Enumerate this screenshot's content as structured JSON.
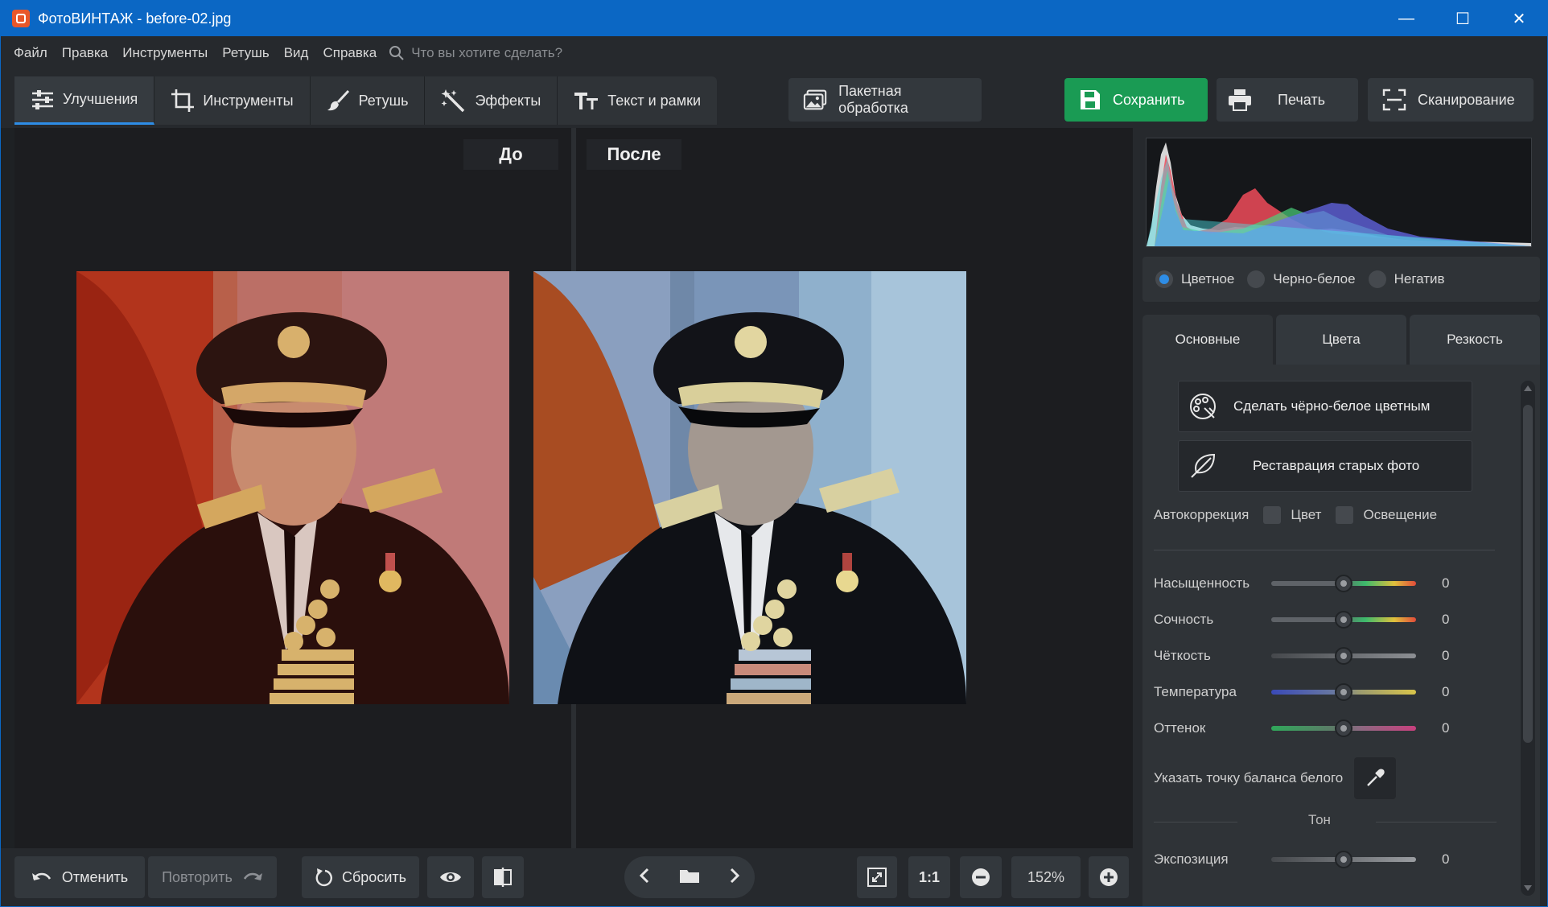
{
  "window": {
    "title": "ФотоВИНТАЖ - before-02.jpg"
  },
  "menu": {
    "items": [
      "Файл",
      "Правка",
      "Инструменты",
      "Ретушь",
      "Вид",
      "Справка"
    ],
    "search_placeholder": "Что вы хотите сделать?"
  },
  "toolbar": {
    "tabs": [
      {
        "label": "Улучшения",
        "icon": "sliders-icon"
      },
      {
        "label": "Инструменты",
        "icon": "crop-icon"
      },
      {
        "label": "Ретушь",
        "icon": "brush-icon"
      },
      {
        "label": "Эффекты",
        "icon": "magic-wand-icon"
      },
      {
        "label": "Текст и рамки",
        "icon": "text-icon"
      }
    ],
    "batch_label": "Пакетная обработка",
    "save_label": "Сохранить",
    "print_label": "Печать",
    "scan_label": "Сканирование"
  },
  "canvas": {
    "before_label": "До",
    "after_label": "После"
  },
  "bottombar": {
    "undo_label": "Отменить",
    "redo_label": "Повторить",
    "reset_label": "Сбросить",
    "zoom_1to1": "1:1",
    "zoom_value": "152%"
  },
  "panel": {
    "modes": [
      "Цветное",
      "Черно-белое",
      "Негатив"
    ],
    "selected_mode": "Цветное",
    "tabs": [
      "Основные",
      "Цвета",
      "Резкость"
    ],
    "active_tab": "Основные",
    "colorize_label": "Сделать чёрно-белое цветным",
    "restore_label": "Реставрация старых фото",
    "autocorr": {
      "label": "Автокоррекция",
      "color": "Цвет",
      "light": "Освещение"
    },
    "sliders": [
      {
        "name": "Насыщенность",
        "value": "0"
      },
      {
        "name": "Сочность",
        "value": "0"
      },
      {
        "name": "Чёткость",
        "value": "0"
      },
      {
        "name": "Температура",
        "value": "0"
      },
      {
        "name": "Оттенок",
        "value": "0"
      }
    ],
    "white_balance_label": "Указать точку баланса белого",
    "tone_header": "Тон",
    "exposure": {
      "name": "Экспозиция",
      "value": "0"
    }
  },
  "colors": {
    "accent": "#2e8de6",
    "save": "#1a9b54",
    "titlebar": "#0b67c4"
  }
}
